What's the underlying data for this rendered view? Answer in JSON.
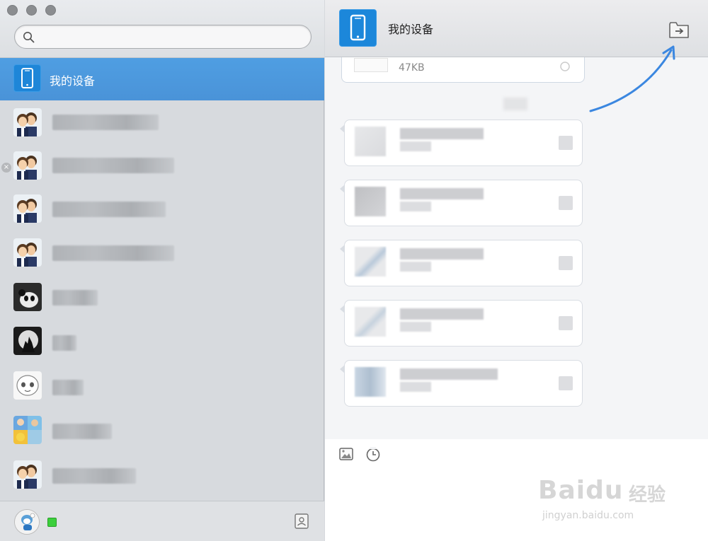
{
  "window": {
    "title": "我的设备"
  },
  "search": {
    "placeholder": "",
    "value": ""
  },
  "sidebar": {
    "selected_contact": {
      "name": "我的设备",
      "icon": "phone-icon"
    },
    "contacts": [
      {
        "avatar": "two-people-avatar",
        "name": ""
      },
      {
        "avatar": "two-people-avatar",
        "name": "",
        "has_close": true
      },
      {
        "avatar": "two-people-avatar",
        "name": ""
      },
      {
        "avatar": "two-people-avatar",
        "name": ""
      },
      {
        "avatar": "panda-avatar",
        "name": ""
      },
      {
        "avatar": "wolf-moon-avatar",
        "name": ""
      },
      {
        "avatar": "cartoon-avatar",
        "name": ""
      },
      {
        "avatar": "photo-collage-avatar",
        "name": ""
      },
      {
        "avatar": "two-people-avatar",
        "name": ""
      }
    ],
    "status_color": "#3ccf3c"
  },
  "main": {
    "header_title": "我的设备",
    "file_size": "47KB",
    "messages_count_visible": 5
  },
  "watermark": {
    "logo": "Baidu",
    "suffix": "经验",
    "url": "jingyan.baidu.com"
  },
  "colors": {
    "accent": "#4a93d8",
    "device_icon": "#1c87da",
    "arrow": "#3b87e0"
  }
}
